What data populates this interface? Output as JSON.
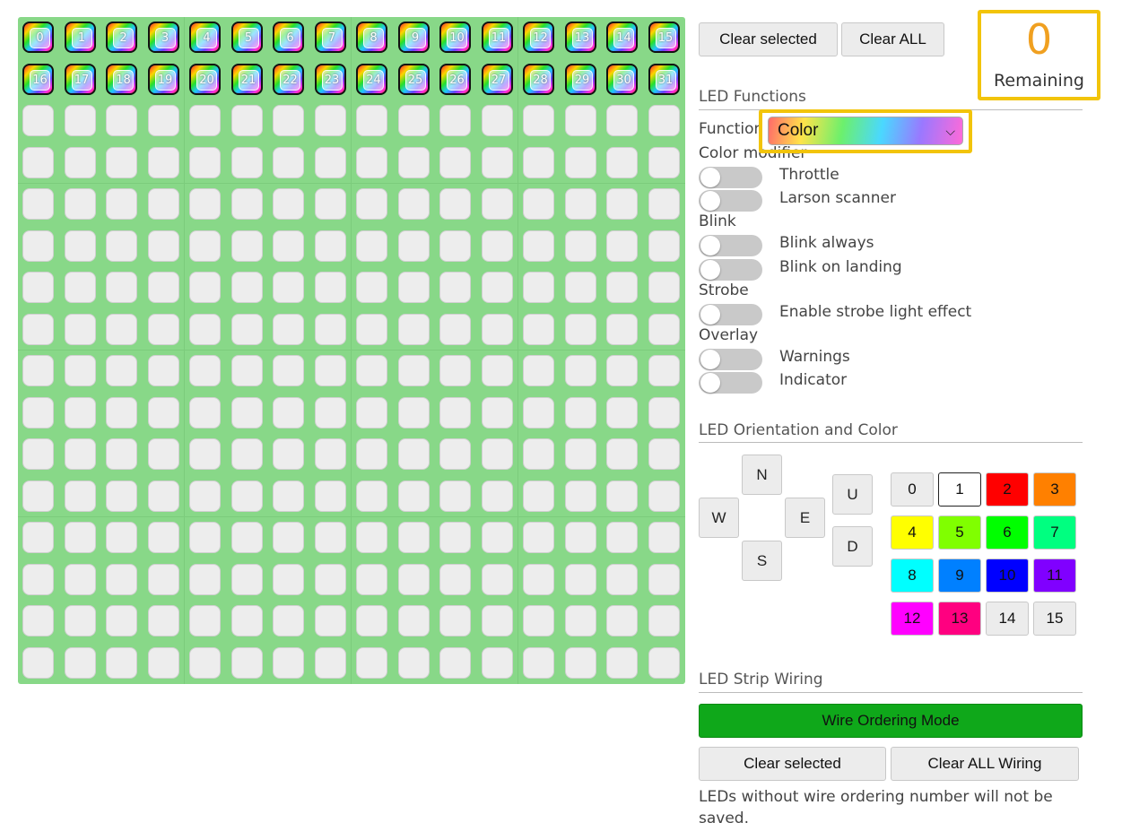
{
  "grid": {
    "cols": 16,
    "rows": 16,
    "wired_leds": [
      0,
      1,
      2,
      3,
      4,
      5,
      6,
      7,
      8,
      9,
      10,
      11,
      12,
      13,
      14,
      15,
      16,
      17,
      18,
      19,
      20,
      21,
      22,
      23,
      24,
      25,
      26,
      27,
      28,
      29,
      30,
      31
    ]
  },
  "top_buttons": {
    "clear_selected": "Clear selected",
    "clear_all": "Clear ALL"
  },
  "remaining": {
    "count": "0",
    "label": "Remaining"
  },
  "led_functions": {
    "title": "LED Functions",
    "function_label": "Function",
    "function_value": "Color",
    "color_modifier_label": "Color modifier",
    "throttle": "Throttle",
    "larson": "Larson scanner",
    "blink_label": "Blink",
    "blink_always": "Blink always",
    "blink_landing": "Blink on landing",
    "strobe_label": "Strobe",
    "strobe": "Enable strobe light effect",
    "overlay_label": "Overlay",
    "warnings": "Warnings",
    "indicator": "Indicator"
  },
  "orientation": {
    "title": "LED Orientation and Color",
    "n": "N",
    "w": "W",
    "e": "E",
    "s": "S",
    "u": "U",
    "d": "D"
  },
  "colors": [
    {
      "label": "0",
      "hex": "#ececec"
    },
    {
      "label": "1",
      "hex": "#ffffff"
    },
    {
      "label": "2",
      "hex": "#ff0000"
    },
    {
      "label": "3",
      "hex": "#ff8000"
    },
    {
      "label": "4",
      "hex": "#ffff00"
    },
    {
      "label": "5",
      "hex": "#80ff00"
    },
    {
      "label": "6",
      "hex": "#00ff00"
    },
    {
      "label": "7",
      "hex": "#00ff80"
    },
    {
      "label": "8",
      "hex": "#00ffff"
    },
    {
      "label": "9",
      "hex": "#0080ff"
    },
    {
      "label": "10",
      "hex": "#0000ff"
    },
    {
      "label": "11",
      "hex": "#8000ff"
    },
    {
      "label": "12",
      "hex": "#ff00ff"
    },
    {
      "label": "13",
      "hex": "#ff0080"
    },
    {
      "label": "14",
      "hex": "#ececec"
    },
    {
      "label": "15",
      "hex": "#ececec"
    }
  ],
  "wiring": {
    "title": "LED Strip Wiring",
    "wire_mode": "Wire Ordering Mode",
    "clear_selected": "Clear selected",
    "clear_all_wiring": "Clear ALL Wiring",
    "note": "LEDs without wire ordering number will not be saved."
  }
}
